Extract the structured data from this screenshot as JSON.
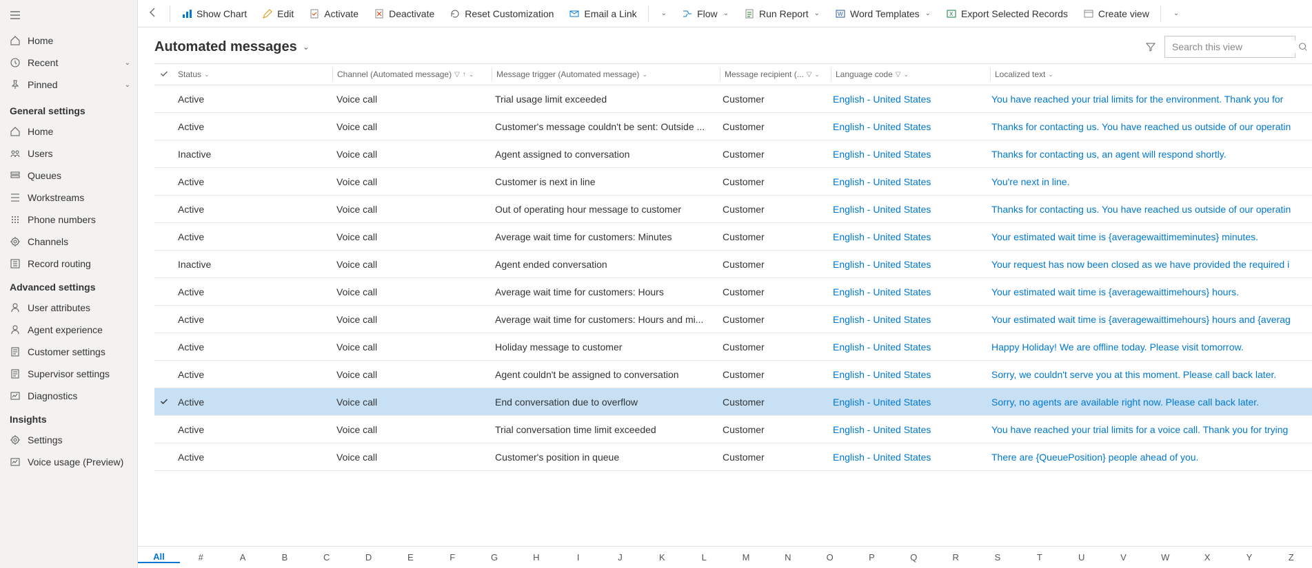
{
  "sidebar": {
    "top": [
      {
        "label": "Home"
      },
      {
        "label": "Recent",
        "chevron": true
      },
      {
        "label": "Pinned",
        "chevron": true
      }
    ],
    "sections": [
      {
        "title": "General settings",
        "items": [
          {
            "label": "Home"
          },
          {
            "label": "Users"
          },
          {
            "label": "Queues"
          },
          {
            "label": "Workstreams"
          },
          {
            "label": "Phone numbers"
          },
          {
            "label": "Channels"
          },
          {
            "label": "Record routing"
          }
        ]
      },
      {
        "title": "Advanced settings",
        "items": [
          {
            "label": "User attributes"
          },
          {
            "label": "Agent experience"
          },
          {
            "label": "Customer settings"
          },
          {
            "label": "Supervisor settings"
          },
          {
            "label": "Diagnostics"
          }
        ]
      },
      {
        "title": "Insights",
        "items": [
          {
            "label": "Settings"
          },
          {
            "label": "Voice usage (Preview)"
          }
        ]
      }
    ]
  },
  "commandbar": {
    "showChart": "Show Chart",
    "edit": "Edit",
    "activate": "Activate",
    "deactivate": "Deactivate",
    "reset": "Reset Customization",
    "emailLink": "Email a Link",
    "flow": "Flow",
    "runReport": "Run Report",
    "wordTemplates": "Word Templates",
    "exportExcel": "Export Selected Records",
    "createView": "Create view"
  },
  "page": {
    "title": "Automated messages",
    "searchPlaceholder": "Search this view"
  },
  "columns": {
    "status": "Status",
    "channel": "Channel (Automated message)",
    "trigger": "Message trigger (Automated message)",
    "recipient": "Message recipient (...",
    "lang": "Language code",
    "text": "Localized text"
  },
  "rows": [
    {
      "status": "Active",
      "channel": "Voice call",
      "trigger": "Trial usage limit exceeded",
      "recipient": "Customer",
      "lang": "English - United States",
      "text": "You have reached your trial limits for the environment. Thank you for"
    },
    {
      "status": "Active",
      "channel": "Voice call",
      "trigger": "Customer's message couldn't be sent: Outside ...",
      "recipient": "Customer",
      "lang": "English - United States",
      "text": "Thanks for contacting us. You have reached us outside of our operatin"
    },
    {
      "status": "Inactive",
      "channel": "Voice call",
      "trigger": "Agent assigned to conversation",
      "recipient": "Customer",
      "lang": "English - United States",
      "text": "Thanks for contacting us, an agent will respond shortly."
    },
    {
      "status": "Active",
      "channel": "Voice call",
      "trigger": "Customer is next in line",
      "recipient": "Customer",
      "lang": "English - United States",
      "text": "You're next in line."
    },
    {
      "status": "Active",
      "channel": "Voice call",
      "trigger": "Out of operating hour message to customer",
      "recipient": "Customer",
      "lang": "English - United States",
      "text": "Thanks for contacting us. You have reached us outside of our operatin"
    },
    {
      "status": "Active",
      "channel": "Voice call",
      "trigger": "Average wait time for customers: Minutes",
      "recipient": "Customer",
      "lang": "English - United States",
      "text": "Your estimated wait time is {averagewaittimeminutes} minutes."
    },
    {
      "status": "Inactive",
      "channel": "Voice call",
      "trigger": "Agent ended conversation",
      "recipient": "Customer",
      "lang": "English - United States",
      "text": "Your request has now been closed as we have provided the required i"
    },
    {
      "status": "Active",
      "channel": "Voice call",
      "trigger": "Average wait time for customers: Hours",
      "recipient": "Customer",
      "lang": "English - United States",
      "text": "Your estimated wait time is {averagewaittimehours} hours."
    },
    {
      "status": "Active",
      "channel": "Voice call",
      "trigger": "Average wait time for customers: Hours and mi...",
      "recipient": "Customer",
      "lang": "English - United States",
      "text": "Your estimated wait time is {averagewaittimehours} hours and {averag"
    },
    {
      "status": "Active",
      "channel": "Voice call",
      "trigger": "Holiday message to customer",
      "recipient": "Customer",
      "lang": "English - United States",
      "text": "Happy Holiday! We are offline today. Please visit tomorrow."
    },
    {
      "status": "Active",
      "channel": "Voice call",
      "trigger": "Agent couldn't be assigned to conversation",
      "recipient": "Customer",
      "lang": "English - United States",
      "text": "Sorry, we couldn't serve you at this moment. Please call back later."
    },
    {
      "status": "Active",
      "channel": "Voice call",
      "trigger": "End conversation due to overflow",
      "recipient": "Customer",
      "lang": "English - United States",
      "text": "Sorry, no agents are available right now. Please call back later.",
      "selected": true
    },
    {
      "status": "Active",
      "channel": "Voice call",
      "trigger": "Trial conversation time limit exceeded",
      "recipient": "Customer",
      "lang": "English - United States",
      "text": "You have reached your trial limits for a voice call. Thank you for trying"
    },
    {
      "status": "Active",
      "channel": "Voice call",
      "trigger": "Customer's position in queue",
      "recipient": "Customer",
      "lang": "English - United States",
      "text": "There are {QueuePosition} people ahead of you."
    }
  ],
  "alpha": [
    "All",
    "#",
    "A",
    "B",
    "C",
    "D",
    "E",
    "F",
    "G",
    "H",
    "I",
    "J",
    "K",
    "L",
    "M",
    "N",
    "O",
    "P",
    "Q",
    "R",
    "S",
    "T",
    "U",
    "V",
    "W",
    "X",
    "Y",
    "Z"
  ]
}
